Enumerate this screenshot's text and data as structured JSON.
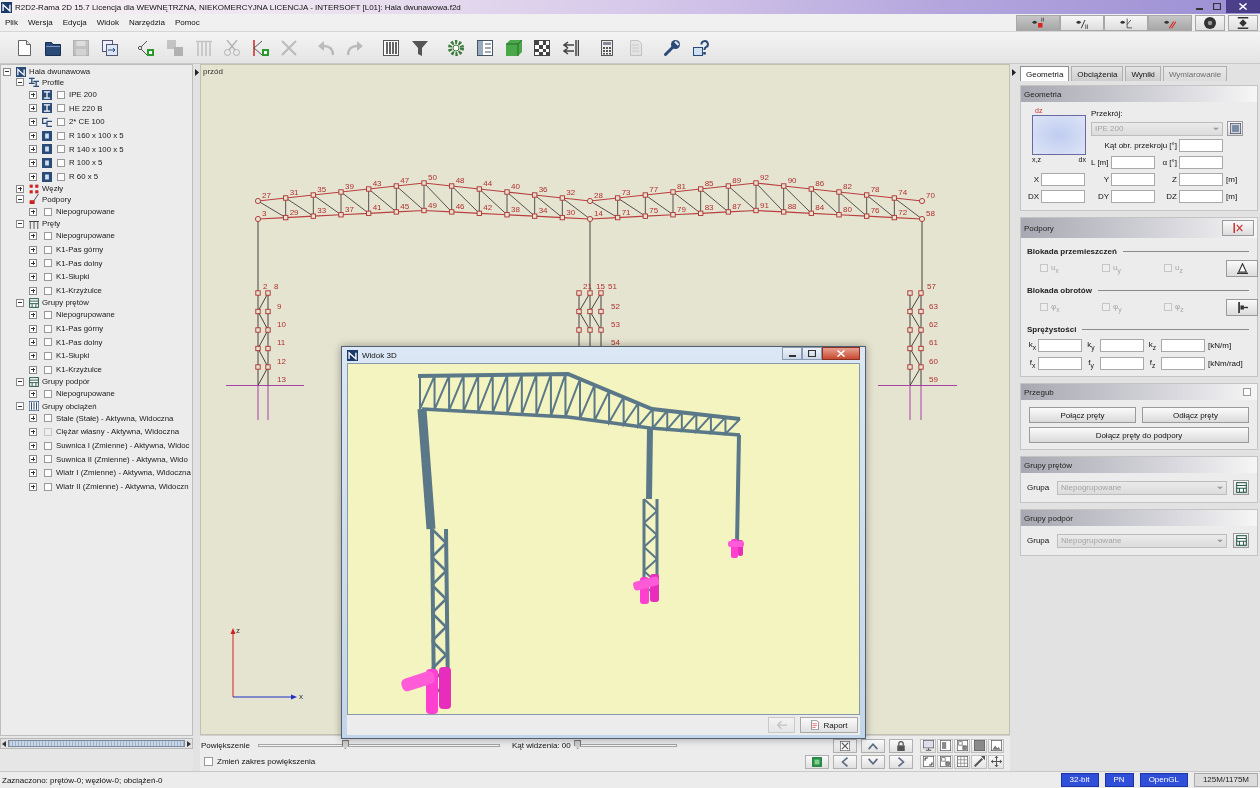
{
  "window": {
    "title": "R2D2-Rama 2D 15.7 Licencja dla WEWNĘTRZNA, NIEKOMERCYJNA LICENCJA - INTERSOFT [L01]: Hala dwunawowa.f2d"
  },
  "menu": [
    "Plik",
    "Wersja",
    "Edycja",
    "Widok",
    "Narzędzia",
    "Pomoc"
  ],
  "view_toggles": [
    {
      "kind": "nodes",
      "on": true
    },
    {
      "kind": "members",
      "on": false
    },
    {
      "kind": "angles",
      "on": false
    },
    {
      "kind": "loads",
      "on": true
    },
    {
      "kind": "dot",
      "on": false
    },
    {
      "kind": "split",
      "on": false
    }
  ],
  "toolbar": [
    {
      "kind": "new",
      "disabled": false
    },
    {
      "kind": "open",
      "disabled": false
    },
    {
      "kind": "save",
      "disabled": true
    },
    {
      "kind": "export",
      "disabled": false
    },
    {
      "kind": "add-node",
      "disabled": false
    },
    {
      "kind": "copy",
      "disabled": true
    },
    {
      "kind": "columns",
      "disabled": true
    },
    {
      "kind": "cut",
      "disabled": true
    },
    {
      "kind": "add-member",
      "disabled": false
    },
    {
      "kind": "delete",
      "disabled": true
    },
    {
      "kind": "undo",
      "disabled": true
    },
    {
      "kind": "redo",
      "disabled": true
    },
    {
      "kind": "table",
      "disabled": false
    },
    {
      "kind": "filter",
      "disabled": false
    },
    {
      "kind": "gear",
      "disabled": false
    },
    {
      "kind": "panel",
      "disabled": false
    },
    {
      "kind": "cube",
      "disabled": false
    },
    {
      "kind": "grid",
      "disabled": false
    },
    {
      "kind": "arrows",
      "disabled": false
    },
    {
      "kind": "calculator",
      "disabled": false
    },
    {
      "kind": "document",
      "disabled": true
    },
    {
      "kind": "wrench",
      "disabled": false
    },
    {
      "kind": "help",
      "disabled": false
    }
  ],
  "tree": {
    "label": "Hala dwunawowa",
    "kind": "model",
    "expanded": true,
    "children": [
      {
        "label": "Profile",
        "kind": "profiles",
        "expanded": true,
        "children": [
          {
            "label": "IPE 200",
            "kind": "ibeam",
            "expanded": false,
            "checked": false
          },
          {
            "label": "HE 220 B",
            "kind": "ibeam",
            "expanded": false,
            "checked": false
          },
          {
            "label": "2* CE 100",
            "kind": "channel",
            "expanded": false,
            "checked": false
          },
          {
            "label": "R 160 x 100 x 5",
            "kind": "tube",
            "expanded": false,
            "checked": false
          },
          {
            "label": "R 140 x 100 x 5",
            "kind": "tube",
            "expanded": false,
            "checked": false
          },
          {
            "label": "R 100 x 5",
            "kind": "tube",
            "expanded": false,
            "checked": false
          },
          {
            "label": "R 60 x 5",
            "kind": "tube",
            "expanded": false,
            "checked": false
          }
        ]
      },
      {
        "label": "Węzły",
        "kind": "nodes",
        "expanded": false
      },
      {
        "label": "Podpory",
        "kind": "supports",
        "expanded": true,
        "children": [
          {
            "label": "Niepogrupowane",
            "kind": "group",
            "expanded": false,
            "checked": false
          }
        ]
      },
      {
        "label": "Pręty",
        "kind": "members",
        "expanded": true,
        "children": [
          {
            "label": "Niepogrupowane",
            "kind": "group",
            "expanded": false,
            "checked": false
          },
          {
            "label": "K1-Pas górny",
            "kind": "group",
            "expanded": false,
            "checked": false
          },
          {
            "label": "K1-Pas dolny",
            "kind": "group",
            "expanded": false,
            "checked": false
          },
          {
            "label": "K1-Słupki",
            "kind": "group",
            "expanded": false,
            "checked": false
          },
          {
            "label": "K1-Krzyżulce",
            "kind": "group",
            "expanded": false,
            "checked": false
          }
        ]
      },
      {
        "label": "Grupy prętów",
        "kind": "member-groups",
        "expanded": true,
        "children": [
          {
            "label": "Niepogrupowane",
            "kind": "group",
            "expanded": false,
            "checked": false
          },
          {
            "label": "K1-Pas górny",
            "kind": "group",
            "expanded": false,
            "checked": false
          },
          {
            "label": "K1-Pas dolny",
            "kind": "group",
            "expanded": false,
            "checked": false
          },
          {
            "label": "K1-Słupki",
            "kind": "group",
            "expanded": false,
            "checked": false
          },
          {
            "label": "K1-Krzyżulce",
            "kind": "group",
            "expanded": false,
            "checked": false
          }
        ]
      },
      {
        "label": "Grupy podpór",
        "kind": "support-groups",
        "expanded": true,
        "children": [
          {
            "label": "Niepogrupowane",
            "kind": "group",
            "expanded": false,
            "checked": false
          }
        ]
      },
      {
        "label": "Grupy obciążeń",
        "kind": "load-groups",
        "expanded": true,
        "children": [
          {
            "label": "Stałe (Stałe) - Aktywna, Widoczna",
            "kind": "group",
            "expanded": false,
            "checked": false,
            "disabled": false
          },
          {
            "label": "Ciężar własny - Aktywna, Widoczna",
            "kind": "group",
            "expanded": false,
            "checked": false,
            "disabled": true
          },
          {
            "label": "Suwnica I (Zmienne) - Aktywna, Widoc",
            "kind": "group",
            "expanded": false,
            "checked": false,
            "disabled": false
          },
          {
            "label": "Suwnica II (Zmienne) - Aktywna, Wido",
            "kind": "group",
            "expanded": false,
            "checked": false,
            "disabled": false
          },
          {
            "label": "Wiatr I (Zmienne) - Aktywna, Widoczna",
            "kind": "group",
            "expanded": false,
            "checked": false,
            "disabled": false
          },
          {
            "label": "Wiatr II (Zmienne) - Aktywna, Widoczn",
            "kind": "group",
            "expanded": false,
            "checked": false,
            "disabled": false
          }
        ]
      }
    ]
  },
  "canvas": {
    "view_label": "przód",
    "spans": [
      {
        "top_nodes": [
          "27",
          "31",
          "35",
          "39",
          "43",
          "47",
          "50",
          "48",
          "44",
          "40",
          "36",
          "32"
        ],
        "bottom_nodes": [
          "3",
          "29",
          "33",
          "37",
          "41",
          "45",
          "49",
          "46",
          "42",
          "38",
          "34",
          "30"
        ]
      },
      {
        "top_nodes": [
          "28",
          "73",
          "77",
          "81",
          "85",
          "89",
          "92",
          "90",
          "86",
          "82",
          "78",
          "74",
          "70"
        ],
        "bottom_nodes": [
          "14",
          "71",
          "75",
          "79",
          "83",
          "87",
          "91",
          "88",
          "84",
          "80",
          "76",
          "72",
          "58"
        ]
      }
    ],
    "columns": [
      {
        "top_labels": [
          "2",
          "8"
        ],
        "side_labels": [
          "9",
          "10",
          "11",
          "12",
          "13"
        ]
      },
      {
        "top_labels": [
          "21",
          "15",
          "51"
        ],
        "side_labels": [
          "52",
          "53",
          "54"
        ]
      },
      {
        "top_labels": [
          "57"
        ],
        "side_labels": [
          "63",
          "62",
          "61",
          "60",
          "59"
        ]
      }
    ],
    "axes": {
      "vertical": "z",
      "horizontal": "x"
    }
  },
  "zoom_bar": {
    "zoom": {
      "label": "Powiększenie",
      "level": 0.36
    },
    "angle": {
      "label": "Kąt widzenia: 00",
      "level": 0.0
    },
    "range": {
      "label": "Zmień zakres powiększenia",
      "checked": false
    }
  },
  "view3d_window": {
    "title": "Widok 3D",
    "back_button": {
      "disabled": true
    },
    "report_button": "Raport"
  },
  "right_panel": {
    "tabs": [
      {
        "label": "Geometria",
        "selected": true,
        "disabled": false
      },
      {
        "label": "Obciążenia",
        "selected": false,
        "disabled": false
      },
      {
        "label": "Wyniki",
        "selected": false,
        "disabled": false
      },
      {
        "label": "Wymiarowanie",
        "selected": false,
        "disabled": true
      }
    ],
    "geometry": {
      "title": "Geometria",
      "preview_labels": {
        "top": "dz",
        "bottom_left": "x,z",
        "bottom_right": "dx"
      },
      "section_label": "Przekrój:",
      "section_select": {
        "value": "IPE 200",
        "disabled": true
      },
      "rotation_label": "Kąt obr. przekroju [°]",
      "length_label": "L [m]",
      "alpha_label": "α [°]",
      "coords": [
        {
          "labels": [
            "X",
            "Y",
            "Z"
          ],
          "unit": "[m]"
        },
        {
          "labels": [
            "DX",
            "DY",
            "DZ"
          ],
          "unit": "[m]"
        }
      ]
    },
    "supports": {
      "title": "Podpory",
      "groups": [
        {
          "title": "Blokada przemieszczeń",
          "kind": "support",
          "options": [
            {
              "label": "u$_{x}$",
              "checked": false,
              "disabled": true
            },
            {
              "label": "u$_{y}$",
              "checked": false,
              "disabled": true
            },
            {
              "label": "u$_{z}$",
              "checked": false,
              "disabled": true
            }
          ]
        },
        {
          "title": "Blokada obrotów",
          "kind": "hinge",
          "options": [
            {
              "label": "φ$_{x}$",
              "checked": false,
              "disabled": true
            },
            {
              "label": "φ$_{y}$",
              "checked": false,
              "disabled": true
            },
            {
              "label": "φ$_{z}$",
              "checked": false,
              "disabled": true
            }
          ]
        }
      ],
      "stiffness_title": "Sprężystości",
      "stiffness_rows": [
        {
          "labels": [
            "k$_{x}$",
            "k$_{y}$",
            "k$_{z}$"
          ],
          "unit": "[kN/m]"
        },
        {
          "labels": [
            "f$_{x}$",
            "f$_{y}$",
            "f$_{z}$"
          ],
          "unit": "[kNm/rad]"
        }
      ]
    },
    "hinge": {
      "title": "Przegub",
      "checked": false,
      "buttons": [
        "Połącz pręty",
        "Odłącz pręty",
        "Dołącz pręty do podpory"
      ]
    },
    "member_groups": {
      "title": "Grupy prętów",
      "label": "Grupa",
      "value": "Niepogrupowane",
      "disabled": true
    },
    "support_groups": {
      "title": "Grupy podpór",
      "label": "Grupa",
      "value": "Niepogrupowane",
      "disabled": true
    }
  },
  "status_bar": {
    "selection": "Zaznaczono: prętów-0; węzłów-0; obciążeń-0",
    "indicators": [
      {
        "label": "32-bit",
        "kind": "highlight"
      },
      {
        "label": "PN",
        "kind": "highlight"
      },
      {
        "label": "OpenGL",
        "kind": "highlight"
      },
      {
        "label": "125M/1175M",
        "kind": "plain"
      }
    ]
  }
}
